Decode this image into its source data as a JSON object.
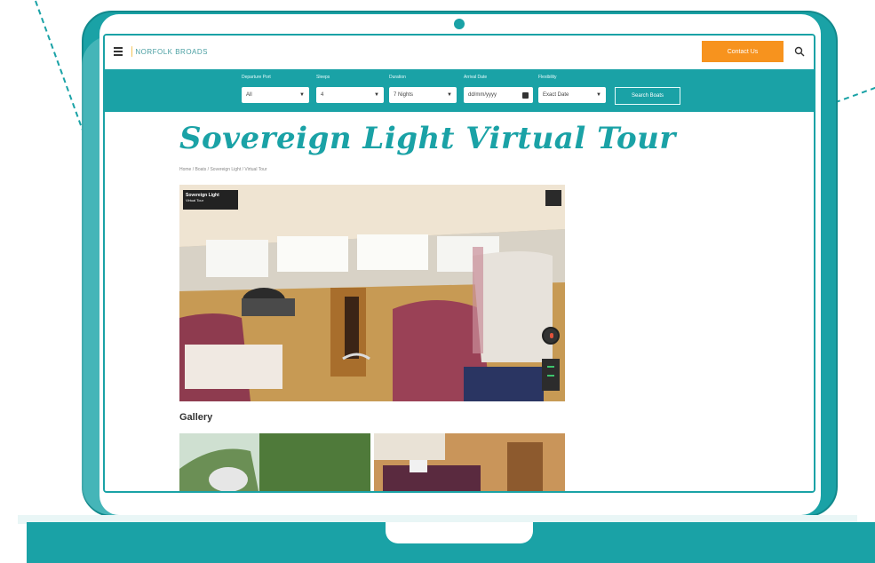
{
  "header": {
    "logo_text": "NORFOLK BROADS",
    "contact_label": "Contact Us"
  },
  "filters": [
    {
      "label": "Departure Port",
      "value": "All",
      "has_calendar": false
    },
    {
      "label": "Sleeps",
      "value": "4",
      "has_calendar": false
    },
    {
      "label": "Duration",
      "value": "7 Nights",
      "has_calendar": false
    },
    {
      "label": "Arrival Date",
      "value": "dd/mm/yyyy",
      "has_calendar": true
    },
    {
      "label": "Flexibility",
      "value": "Exact Date",
      "has_calendar": false
    }
  ],
  "search_label": "Search Boats",
  "page": {
    "title": "Sovereign Light Virtual Tour",
    "breadcrumb": "Home / Boats / Sovereign Light / Virtual Tour"
  },
  "tour": {
    "chip_title": "Sovereign Light",
    "chip_subtitle": "Virtual Tour"
  },
  "gallery_heading": "Gallery",
  "colors": {
    "brand_teal": "#1aa2a6",
    "accent_orange": "#f7931e"
  },
  "icons": [
    "menu-icon",
    "search-icon",
    "chevron-down-icon",
    "calendar-icon",
    "fullscreen-icon",
    "compass-icon",
    "zoom-icon"
  ]
}
